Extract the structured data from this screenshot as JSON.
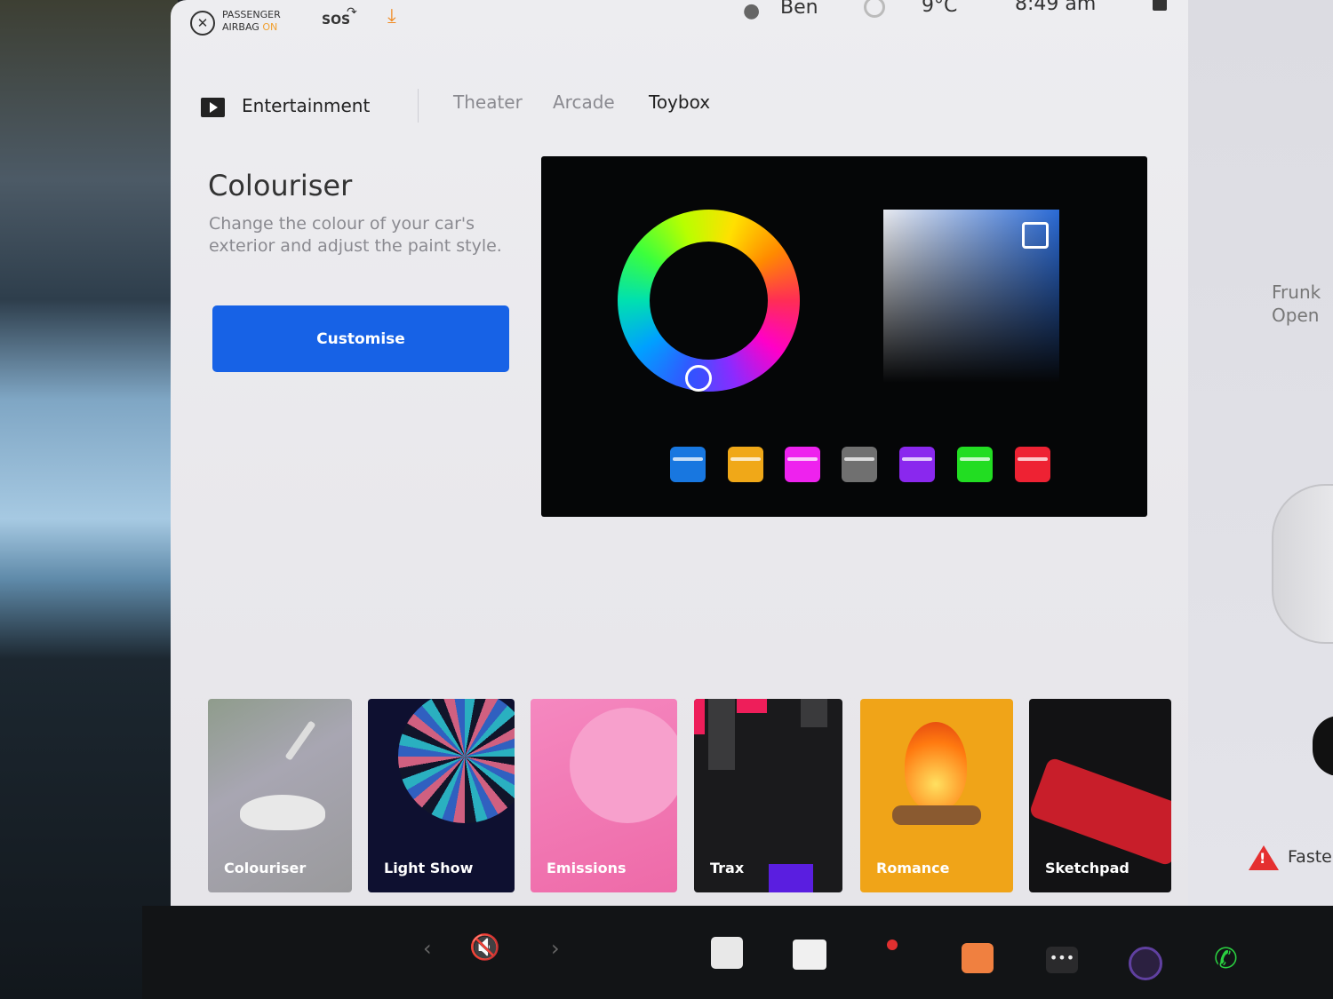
{
  "status_bar": {
    "airbag_line1": "PASSENGER",
    "airbag_line2": "AIRBAG",
    "airbag_status": "ON",
    "sos": "SOS",
    "user_name": "Ben",
    "temperature": "9°C",
    "time": "8:49 am"
  },
  "tabs": {
    "section": "Entertainment",
    "items": [
      "Theater",
      "Arcade",
      "Toybox"
    ],
    "active": "Toybox"
  },
  "colouriser": {
    "title": "Colouriser",
    "description": "Change the colour of your car's exterior and adjust the paint style.",
    "button_label": "Customise"
  },
  "swatches": [
    "#1877e0",
    "#f0a818",
    "#ee22ee",
    "#707070",
    "#8a28ee",
    "#22dd22",
    "#ee2233"
  ],
  "apps": [
    {
      "label": "Colouriser",
      "bg": "#9a9a9c"
    },
    {
      "label": "Light Show",
      "bg": "#0e1030"
    },
    {
      "label": "Emissions",
      "bg": "#f070b0"
    },
    {
      "label": "Trax",
      "bg": "#1a1a1c"
    },
    {
      "label": "Romance",
      "bg": "#f0a418"
    },
    {
      "label": "Sketchpad",
      "bg": "#121214"
    }
  ],
  "side_panel": {
    "frunk_line1": "Frunk",
    "frunk_line2": "Open",
    "seatbelt_warning": "Faste"
  },
  "dock": {
    "volume_icon": "mute-icon",
    "items": [
      "notes-icon",
      "theater-icon",
      "joystick-icon",
      "toybox-icon",
      "more-icon",
      "camera-icon",
      "phone-icon"
    ]
  }
}
